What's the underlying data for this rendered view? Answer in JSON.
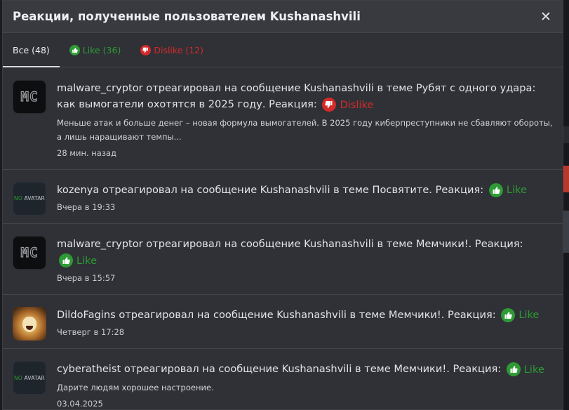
{
  "modal": {
    "title": "Реакции, полученные пользователем Kushanashvili",
    "close_label": "✕"
  },
  "tabs": [
    {
      "label": "Все (48)"
    },
    {
      "label": "Like (36)"
    },
    {
      "label": "Dislike (12)"
    }
  ],
  "reaction_labels": {
    "like": "Like",
    "dislike": "Dislike"
  },
  "colors": {
    "like": "#2f9a35",
    "dislike": "#d32a2a"
  },
  "items": [
    {
      "avatar": "MC",
      "text": "malware_cryptor отреагировал на сообщение Kushanashvili в теме Рубят с одного удара: как вымогатели охотятся в 2025 году. Реакция:",
      "reaction": "Dislike",
      "snippet": "Меньше атак и больше денег – новая формула вымогателей. В 2025 году киберпреступники не сбавляют обороты, а лишь наращивают темпы...",
      "time": "28 мин. назад"
    },
    {
      "avatar": "NO AVATAR",
      "text": "kozenya отреагировал на сообщение Kushanashvili в теме Посвятите. Реакция:",
      "reaction": "Like",
      "time": "Вчера в 19:33"
    },
    {
      "avatar": "MC",
      "text": "malware_cryptor отреагировал на сообщение Kushanashvili в теме Мемчики!. Реакция:",
      "reaction": "Like",
      "time": "Вчера в 15:57"
    },
    {
      "avatar": "lion",
      "text": "DildoFagins отреагировал на сообщение Kushanashvili в теме Мемчики!. Реакция:",
      "reaction": "Like",
      "time": "Четверг в 17:28"
    },
    {
      "avatar": "NO AVATAR",
      "text": "cyberatheist отреагировал на сообщение Kushanashvili в теме Мемчики!. Реакция:",
      "reaction": "Like",
      "snippet": "Дарите людям хорошее настроение.",
      "time": "03.04.2025"
    }
  ]
}
